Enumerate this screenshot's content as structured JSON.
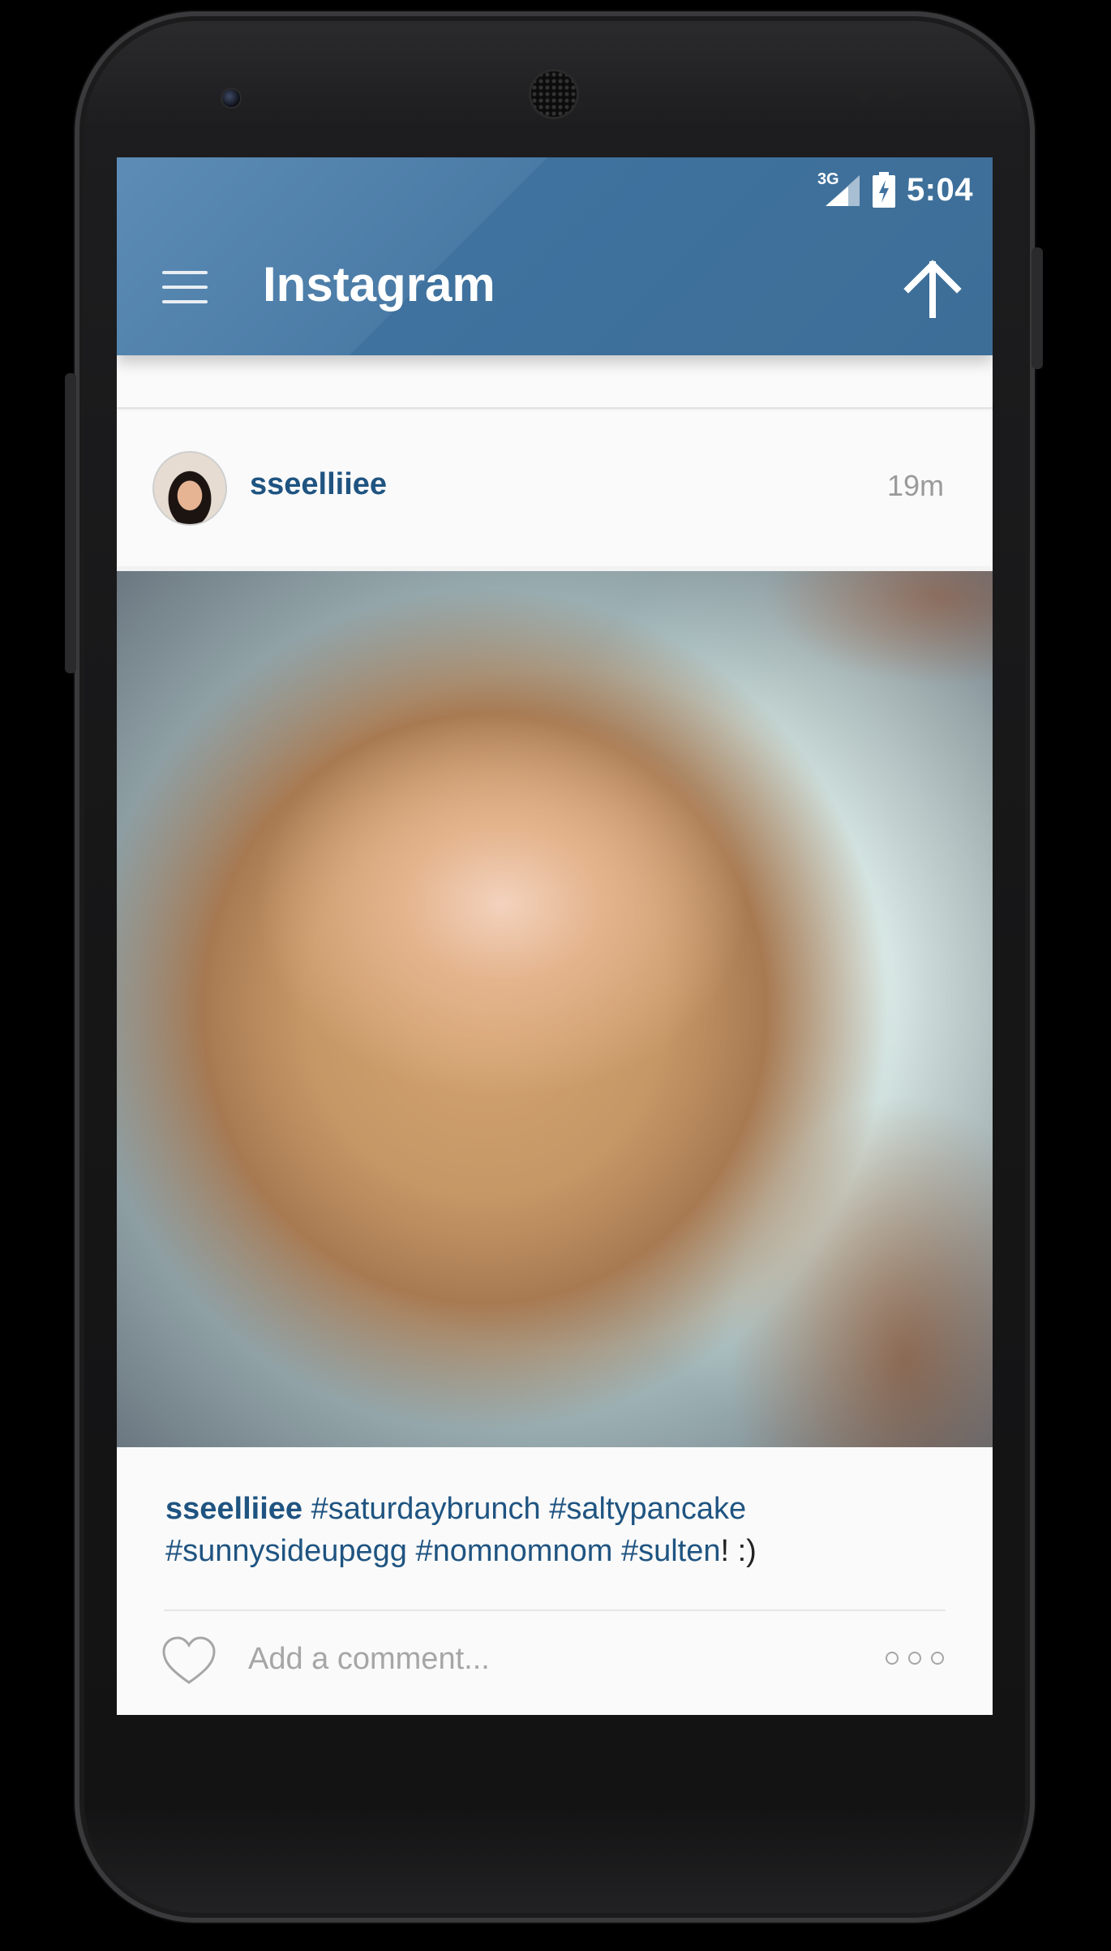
{
  "status_bar": {
    "network": "3G",
    "time": "5:04"
  },
  "app_bar": {
    "title": "Instagram",
    "menu_icon": "menu-icon",
    "upload_icon": "arrow-up-icon"
  },
  "post": {
    "username": "sseelliiee",
    "time_ago": "19m",
    "caption_user": "sseelliiee",
    "caption_tags": [
      "#saturdaybrunch",
      "#saltypancake",
      "#sunnysideupegg",
      "#nomnomnom",
      "#sulten"
    ],
    "caption_suffix": "! :)",
    "comment_placeholder": "Add a comment...",
    "like_icon": "heart-icon",
    "more_icon": "more-options-icon"
  },
  "colors": {
    "accent": "#1f5481",
    "app_bar": "#3f729e"
  }
}
